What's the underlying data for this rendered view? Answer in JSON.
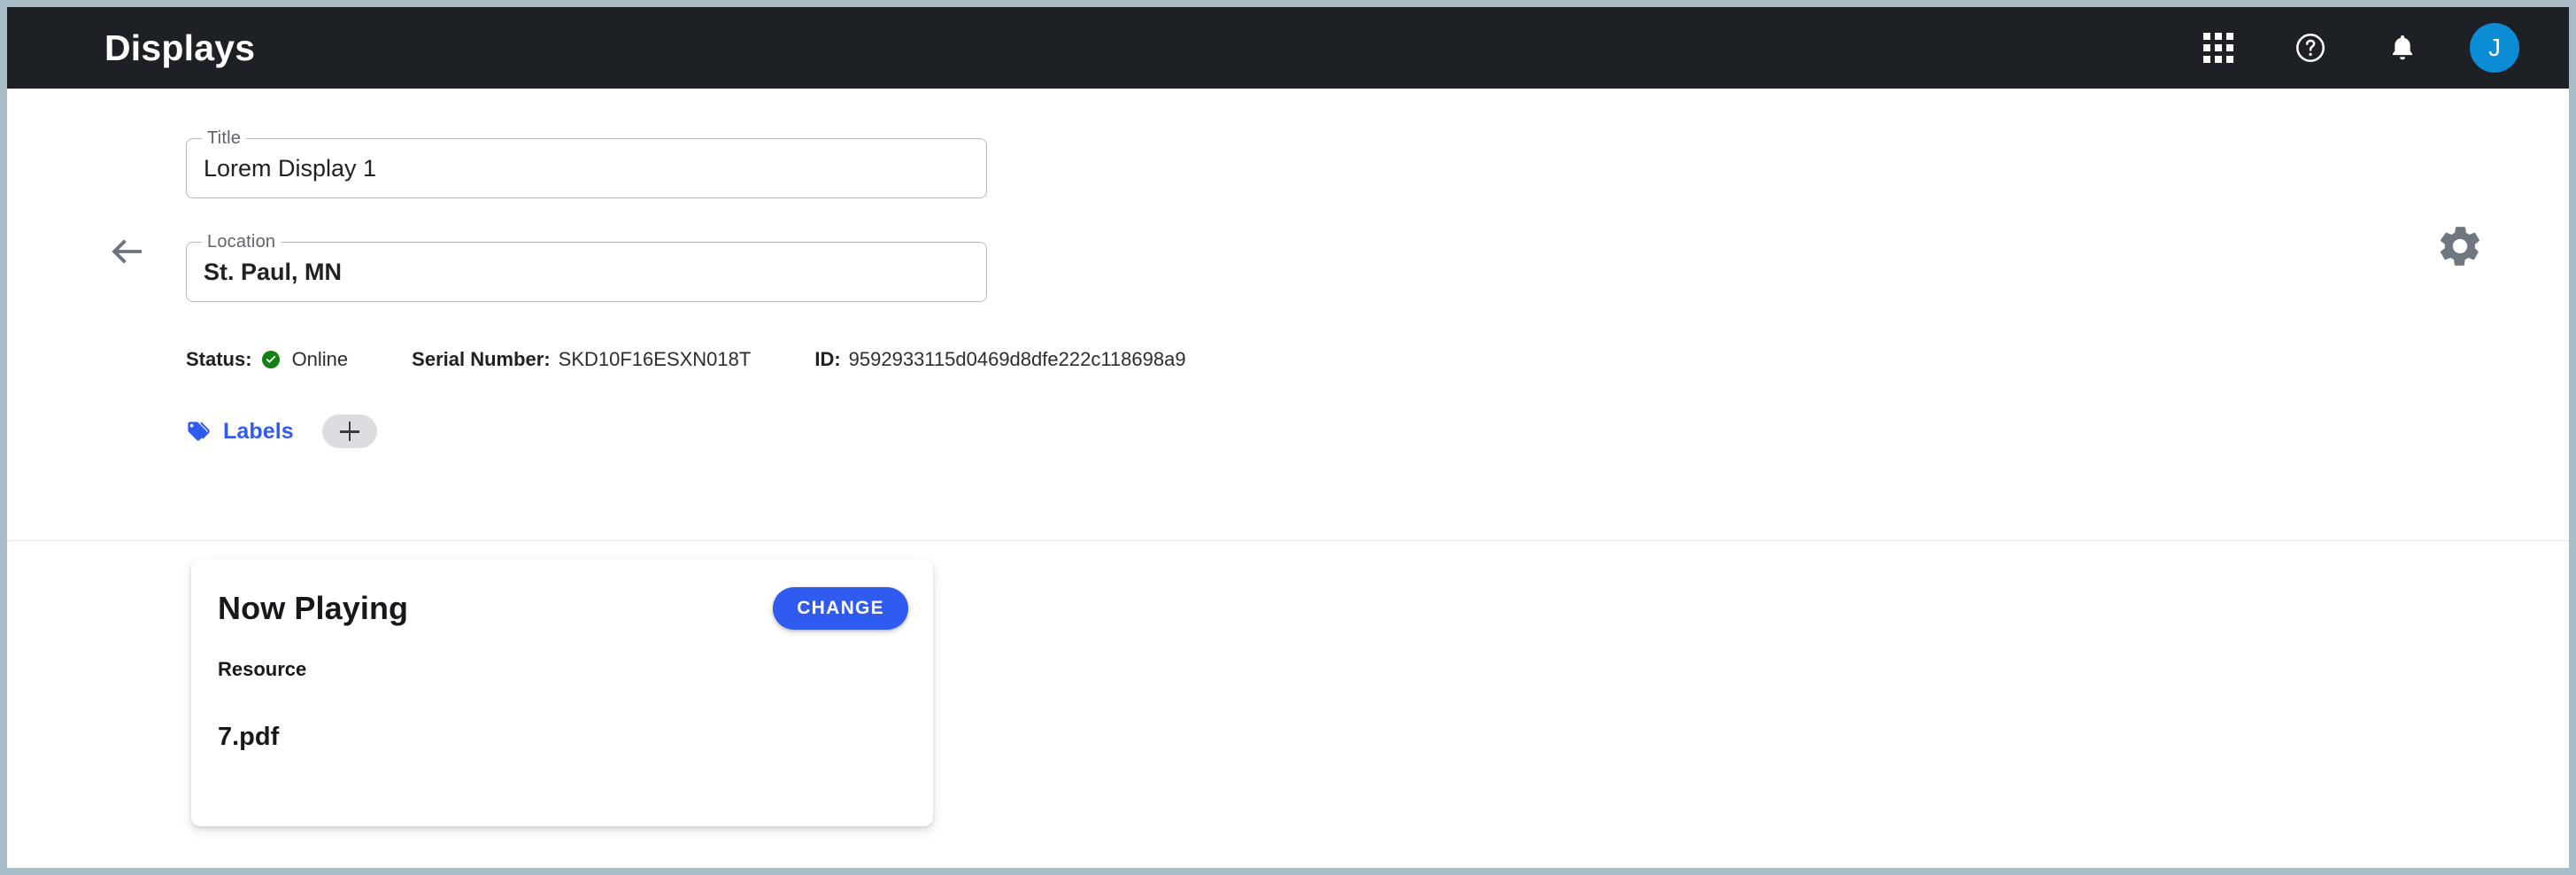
{
  "appbar": {
    "title": "Displays",
    "icons": {
      "apps": "apps-grid-icon",
      "help": "help-circle-icon",
      "notifications": "bell-icon"
    },
    "avatar_initial": "J",
    "avatar_color": "#0c8cd5",
    "background_color": "#1d2025"
  },
  "detail": {
    "back_icon": "arrow-left-icon",
    "settings_icon": "gear-icon",
    "fields": [
      {
        "label": "Title",
        "value": "Lorem Display 1"
      },
      {
        "label": "Location",
        "value": "St. Paul, MN"
      }
    ],
    "meta": {
      "status_label": "Status:",
      "status_value": "Online",
      "status_icon": "check-circle-icon",
      "status_color": "#128012",
      "serial_label": "Serial Number:",
      "serial_value": "SKD10F16ESXN018T",
      "id_label": "ID:",
      "id_value": "9592933115d0469d8dfe222c118698a9"
    },
    "labels": {
      "icon": "tags-icon",
      "text": "Labels",
      "add_button": "+",
      "accent_color": "#2f5bf0"
    }
  },
  "now_playing": {
    "title": "Now Playing",
    "change_button": "CHANGE",
    "change_button_color": "#2f5bf0",
    "resource_label": "Resource",
    "resource_value": "7.pdf"
  }
}
